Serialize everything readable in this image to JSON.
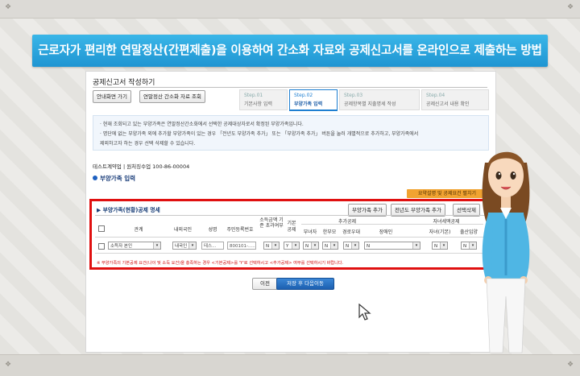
{
  "banner": {
    "title": "근로자가 편리한 연말정산(간편제출)을 이용하여 간소화 자료와 공제신고서를 온라인으로 제출하는 방법"
  },
  "panel": {
    "title": "공제신고서 작성하기",
    "guide_button": "안내화면 가기",
    "lookup_button": "연말정산 간소화 자료 조회",
    "steps": [
      {
        "num": "Step.01",
        "label": "기본사항 입력"
      },
      {
        "num": "Step.02",
        "label": "부양가족 입력"
      },
      {
        "num": "Step.03",
        "label": "공제항목별 지출명세 작성"
      },
      {
        "num": "Step.04",
        "label": "공제신고서 내용 확인"
      }
    ],
    "info_lines": [
      "· 현재 조회되고 있는 부양가족은 연말정산간소화에서 선택한 공제대상자로서 확정된 부양가족입니다.",
      "· 명단에 없는 부양가족 외에 추가할 부양가족이 있는 경우 「전년도 부양가족 추가」 또는 「부양가족 추가」 버튼을 눌러 개별적으로 추가하고, 부양가족에서",
      "  제외하고자 하는 경우 선택 삭제할 수 있습니다."
    ],
    "taxpayer_line": "테스트계약업  |  원처징수업 100-86-00004",
    "section_title": "부양가족 입력",
    "orange_button": "요약설명 및 공제요건 펼치기"
  },
  "dependents": {
    "title": "부양가족(현황)공제 명세",
    "add_button": "부양가족 추가",
    "prev_year_button": "전년도 부양가족 추가",
    "delete_button": "선택삭제",
    "headers": {
      "relation": "관계",
      "nationality": "내외국인",
      "name": "성명",
      "rrn": "주민등록번호",
      "income": "소득금액 기준 초과여부",
      "basic": "기본 공제",
      "extra": "추가공제",
      "child": "자녀세액공제",
      "woman": "부녀자",
      "single_parent": "한부모",
      "senior": "경로우대",
      "disabled": "장애인",
      "child_basic": "자녀(기본)",
      "birth": "출산입양"
    },
    "row": {
      "relation": "소득자 본인",
      "nationality": "내국인",
      "name": "테스...",
      "rrn": "800101-......",
      "income": "N",
      "basic": "Y",
      "woman": "N",
      "single_parent": "N",
      "senior": "N",
      "disabled": "N",
      "child_basic": "N",
      "birth": "N"
    },
    "note": "※ 부양가족의 기본공제 요건(나이 및 소득 요건)을 충족하는 경우 <기본공제>를 'Y'로 선택하시고 <추가공제> 여부를 선택하시기 바랍니다."
  },
  "nav": {
    "prev": "이전",
    "next": "저장 후 다음이동"
  },
  "colors": {
    "banner": "#1f95d2",
    "highlight_box": "#e01010",
    "accent": "#1e60c0",
    "orange": "#f1a331"
  }
}
